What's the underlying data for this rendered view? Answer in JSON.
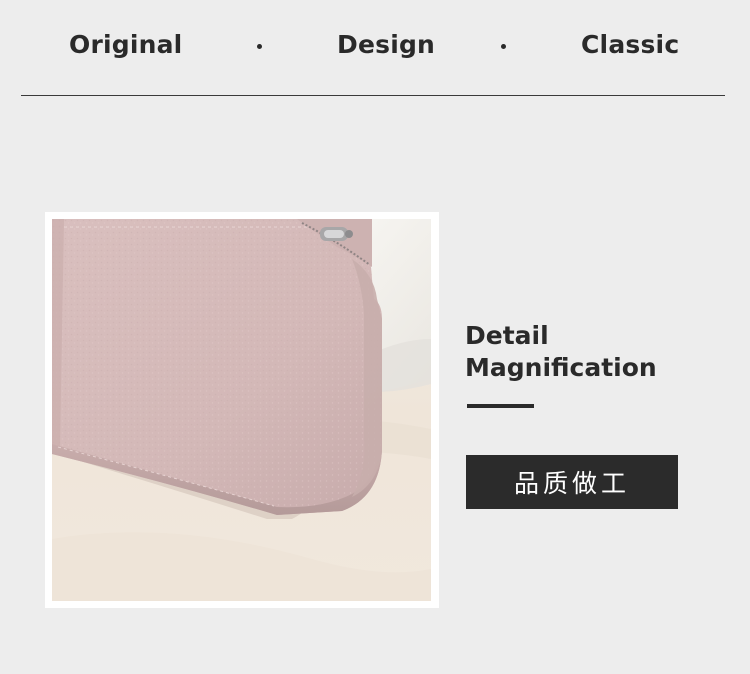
{
  "header": {
    "words": [
      "Original",
      "Design",
      "Classic"
    ]
  },
  "photo": {
    "subject": "wallet-photo",
    "colors": {
      "leather": "#d6bcbc",
      "leather_shadow": "#b99f9f",
      "background": "#f0e7dc",
      "box": "#f7f6f2"
    }
  },
  "detail": {
    "title_line1": "Detail",
    "title_line2": "Magnification",
    "badge": "品质做工"
  },
  "colors": {
    "page_background": "#ededed",
    "text": "#2a2a2a",
    "badge_background": "#2b2b2b",
    "badge_text": "#ffffff"
  }
}
